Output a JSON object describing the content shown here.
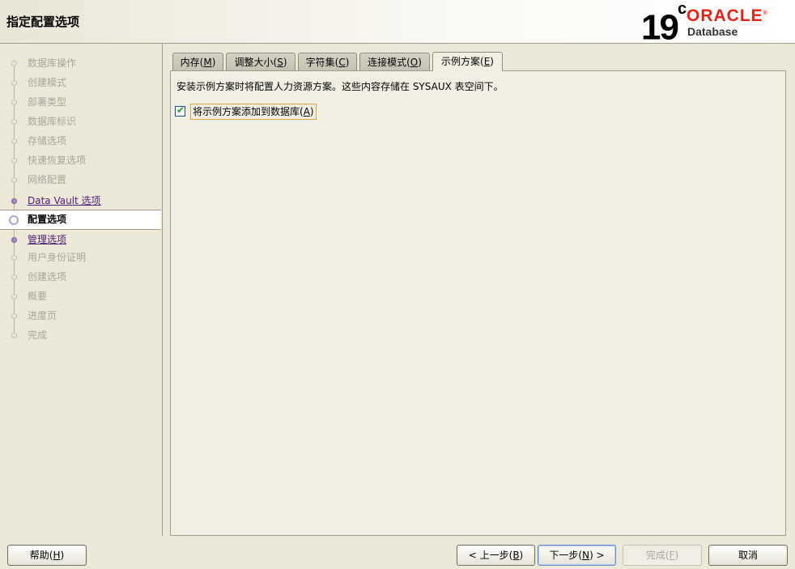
{
  "header": {
    "title": "指定配置选项",
    "logo_version": "19",
    "logo_version_sup": "c",
    "logo_brand": "ORACLE",
    "logo_brand_mark": "®",
    "logo_product": "Database"
  },
  "sidebar": {
    "items": [
      {
        "label": "数据库操作",
        "state": "disabled"
      },
      {
        "label": "创建模式",
        "state": "disabled"
      },
      {
        "label": "部署类型",
        "state": "disabled"
      },
      {
        "label": "数据库标识",
        "state": "disabled"
      },
      {
        "label": "存储选项",
        "state": "disabled"
      },
      {
        "label": "快速恢复选项",
        "state": "disabled"
      },
      {
        "label": "网络配置",
        "state": "disabled"
      },
      {
        "label": "Data Vault 选项",
        "state": "link"
      },
      {
        "label": "配置选项",
        "state": "current"
      },
      {
        "label": "管理选项",
        "state": "link"
      },
      {
        "label": "用户身份证明",
        "state": "disabled"
      },
      {
        "label": "创建选项",
        "state": "disabled"
      },
      {
        "label": "概要",
        "state": "disabled"
      },
      {
        "label": "进度页",
        "state": "disabled"
      },
      {
        "label": "完成",
        "state": "disabled"
      }
    ]
  },
  "tabs": [
    {
      "label": "内存",
      "mnemonic": "M"
    },
    {
      "label": "调整大小",
      "mnemonic": "S"
    },
    {
      "label": "字符集",
      "mnemonic": "C"
    },
    {
      "label": "连接模式",
      "mnemonic": "O"
    },
    {
      "label": "示例方案",
      "mnemonic": "E",
      "active": true
    }
  ],
  "content": {
    "description": "安装示例方案时将配置人力资源方案。这些内容存储在 SYSAUX 表空间下。",
    "checkbox_label": "将示例方案添加到数据库",
    "checkbox_mnemonic": "A",
    "checkbox_checked": true,
    "check_glyph": "✔"
  },
  "buttons": {
    "help": {
      "label": "帮助",
      "mnemonic": "H"
    },
    "back": {
      "label": "< 上一步",
      "mnemonic": "B"
    },
    "next": {
      "label": "下一步",
      "mnemonic": "N",
      "suffix": " >"
    },
    "finish": {
      "label": "完成",
      "mnemonic": "F"
    },
    "cancel": {
      "label": "取消"
    }
  },
  "colors": {
    "background": "#ece9d8",
    "brand_red": "#e2231a",
    "link_purple": "#4d1b74"
  }
}
